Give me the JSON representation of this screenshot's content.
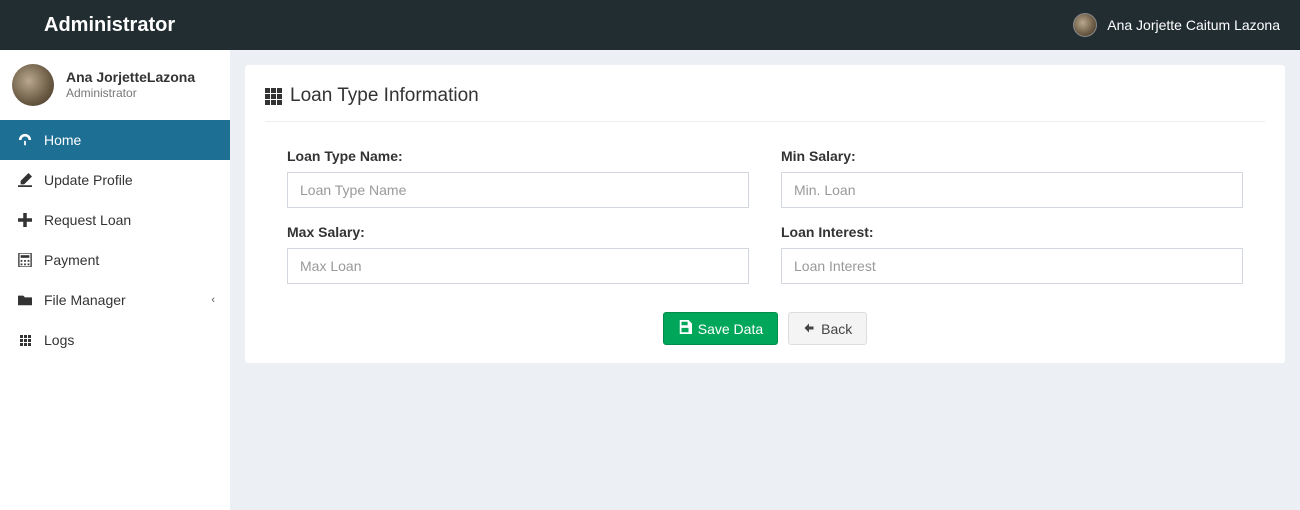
{
  "header": {
    "logo": "Administrator",
    "user_name": "Ana Jorjette Caitum Lazona"
  },
  "sidebar": {
    "user_name": "Ana JorjetteLazona",
    "user_role": "Administrator",
    "items": [
      {
        "icon": "dashboard-icon",
        "label": "Home",
        "active": true
      },
      {
        "icon": "pencil-icon",
        "label": "Update Profile"
      },
      {
        "icon": "plus-icon",
        "label": "Request Loan"
      },
      {
        "icon": "calculator-icon",
        "label": "Payment"
      },
      {
        "icon": "folder-icon",
        "label": "File Manager",
        "has_children": true
      },
      {
        "icon": "grid-icon",
        "label": "Logs"
      }
    ]
  },
  "main": {
    "title": "Loan Type Information",
    "fields": {
      "loan_type_name": {
        "label": "Loan Type Name:",
        "placeholder": "Loan Type Name",
        "value": ""
      },
      "min_salary": {
        "label": "Min Salary:",
        "placeholder": "Min. Loan",
        "value": ""
      },
      "max_salary": {
        "label": "Max Salary:",
        "placeholder": "Max Loan",
        "value": ""
      },
      "loan_interest": {
        "label": "Loan Interest:",
        "placeholder": "Loan Interest",
        "value": ""
      }
    },
    "buttons": {
      "save": "Save Data",
      "back": "Back"
    }
  }
}
